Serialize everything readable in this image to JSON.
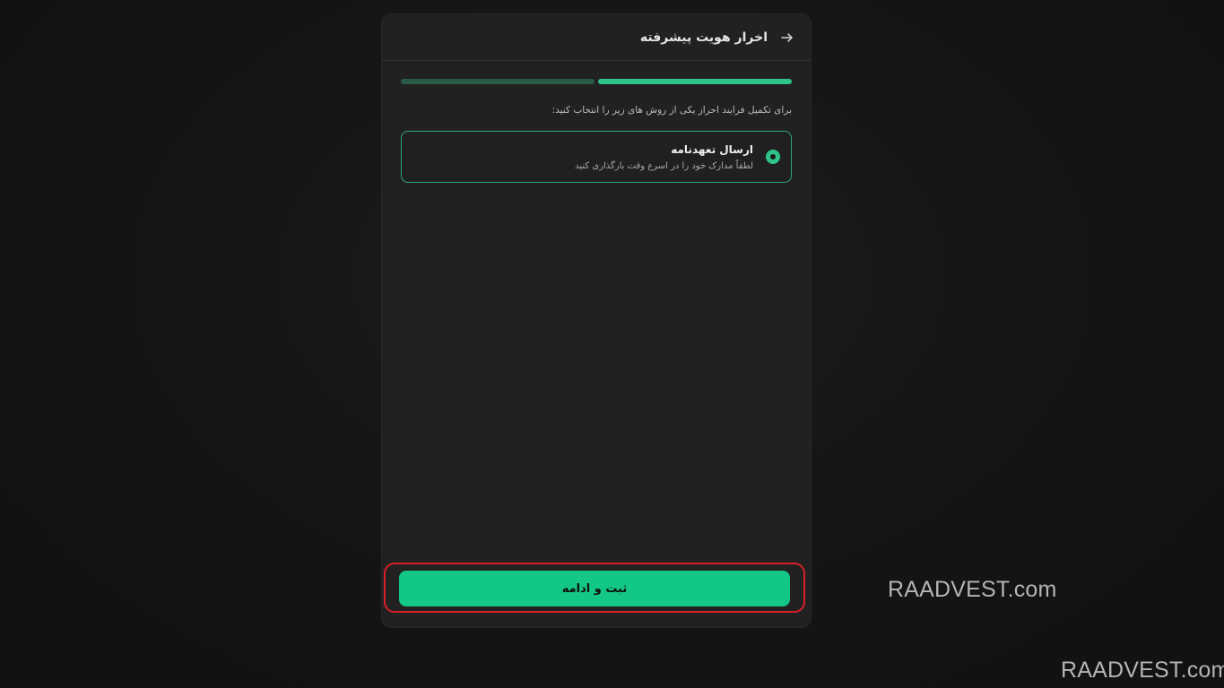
{
  "header": {
    "title": "اخرار هویت پیشرفته",
    "back_icon": "arrow-right-icon"
  },
  "progress": {
    "total_steps": 2,
    "current_step": 1
  },
  "instruction": "برای تکمیل فرایند احراز یکی از روش های زیر را انتخاب کنید:",
  "option": {
    "title": "ارسال تعهدنامه",
    "description": "لطفاً مدارک خود را در اسرع وقت بارگذاری کنید",
    "selected": true
  },
  "submit": {
    "label": "ثبت و ادامه"
  },
  "watermarks": [
    "RAADVEST.com",
    "RAADVEST.com"
  ],
  "colors": {
    "accent": "#13c886",
    "highlight": "#d81f26"
  }
}
